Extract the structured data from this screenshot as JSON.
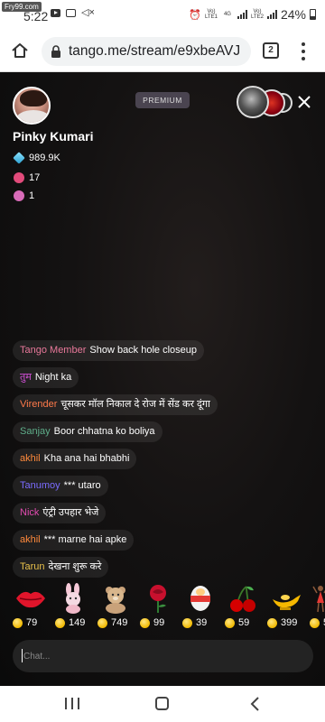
{
  "status_bar": {
    "watermark": "Fry99.com",
    "time": "5:22",
    "net1": "Vo) LTE1",
    "net2": "4G",
    "net3": "Vo) LTE2",
    "battery": "24%"
  },
  "browser": {
    "url": "tango.me/stream/e9xbeAVJ",
    "tab_count": "2"
  },
  "stream": {
    "badge": "PREMIUM",
    "streamer_name": "Pinky Kumari",
    "stats": {
      "diamonds": "989.9K",
      "fans": "17",
      "stars": "1"
    }
  },
  "chat": {
    "messages": [
      {
        "user": "Tango Member",
        "text": "Show back hole closeup",
        "color": "#e8789a"
      },
      {
        "user": "तुम",
        "text": "Night ka",
        "color": "#d34fd8"
      },
      {
        "user": "Virender",
        "text": "चूसकर मॉल निकाल दे रोज में सेंड कर दूंगा",
        "color": "#ff7a4a"
      },
      {
        "user": "Sanjay",
        "text": "Boor chhatna ko boliya",
        "color": "#5fae8a"
      },
      {
        "user": "akhil",
        "text": "Kha ana hai bhabhi",
        "color": "#ff8a3c"
      },
      {
        "user": "Tanumoy",
        "text": "*** utaro",
        "color": "#7b6cff"
      },
      {
        "user": "Nick",
        "text": "एंट्री उपहार भेजे",
        "color": "#e24bb0"
      },
      {
        "user": "akhil",
        "text": "*** marne hai apke",
        "color": "#ff8a3c"
      },
      {
        "user": "Tarun",
        "text": "देखना शुरू करे",
        "color": "#e8c14b"
      }
    ],
    "input_placeholder": "Chat..."
  },
  "gifts": [
    {
      "icon": "lips-icon",
      "price": "79"
    },
    {
      "icon": "bunny-icon",
      "price": "149"
    },
    {
      "icon": "teddy-bear-icon",
      "price": "749"
    },
    {
      "icon": "rose-icon",
      "price": "99"
    },
    {
      "icon": "egg-icon",
      "price": "39"
    },
    {
      "icon": "cherries-icon",
      "price": "59"
    },
    {
      "icon": "magic-lamp-icon",
      "price": "399"
    },
    {
      "icon": "dancers-icon",
      "price": "5"
    }
  ],
  "colors": {
    "accent_coin": "#f0b800",
    "stream_bg": "#0d0d0d"
  }
}
